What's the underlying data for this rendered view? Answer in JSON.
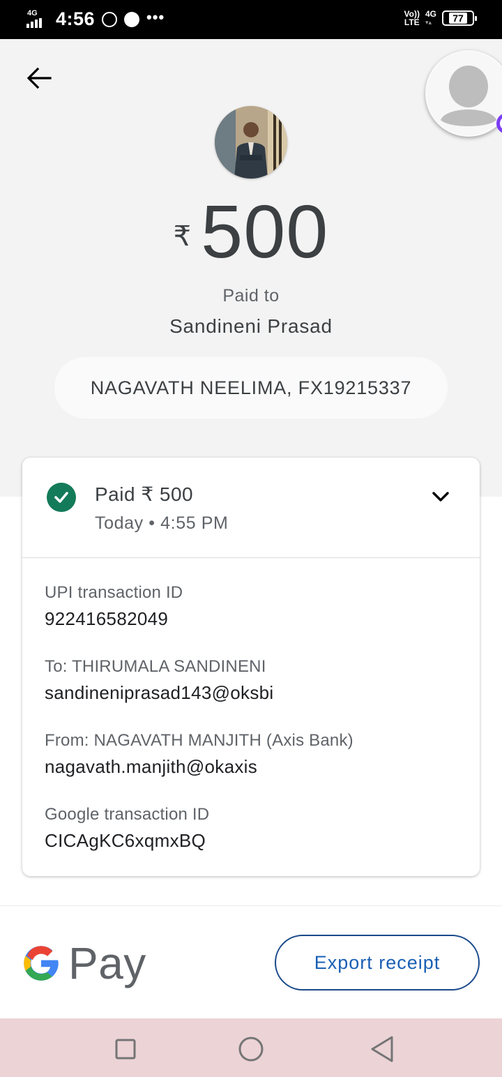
{
  "status_bar": {
    "network_type": "4G",
    "time": "4:56",
    "volte_label_top": "Vo))",
    "volte_label_bottom": "LTE",
    "network_right": "4G",
    "battery_level": "77"
  },
  "header": {
    "back_icon": "arrow-back-icon",
    "account_avatar_icon": "person-silhouette-icon"
  },
  "payment": {
    "currency_symbol": "₹",
    "amount": "500",
    "paid_to_label": "Paid to",
    "payee_name": "Sandineni Prasad",
    "note": "NAGAVATH NEELIMA, FX19215337"
  },
  "status_card": {
    "status_title": "Paid ₹ 500",
    "status_time": "Today • 4:55 PM",
    "check_icon": "check-circle-icon",
    "expand_icon": "chevron-down-icon",
    "details": [
      {
        "label": "UPI transaction ID",
        "value": "922416582049"
      },
      {
        "label": "To: THIRUMALA  SANDINENI",
        "value": "sandineniprasad143@oksbi"
      },
      {
        "label": "From: NAGAVATH MANJITH (Axis Bank)",
        "value": "nagavath.manjith@okaxis"
      },
      {
        "label": "Google transaction ID",
        "value": "CICAgKC6xqmxBQ"
      }
    ]
  },
  "footer": {
    "brand_text": "Pay",
    "export_label": "Export receipt"
  },
  "colors": {
    "header_bg": "#f3f3f3",
    "success_green": "#137b59",
    "export_blue": "#1a5fb4",
    "nav_bg": "#ecd3d6"
  }
}
